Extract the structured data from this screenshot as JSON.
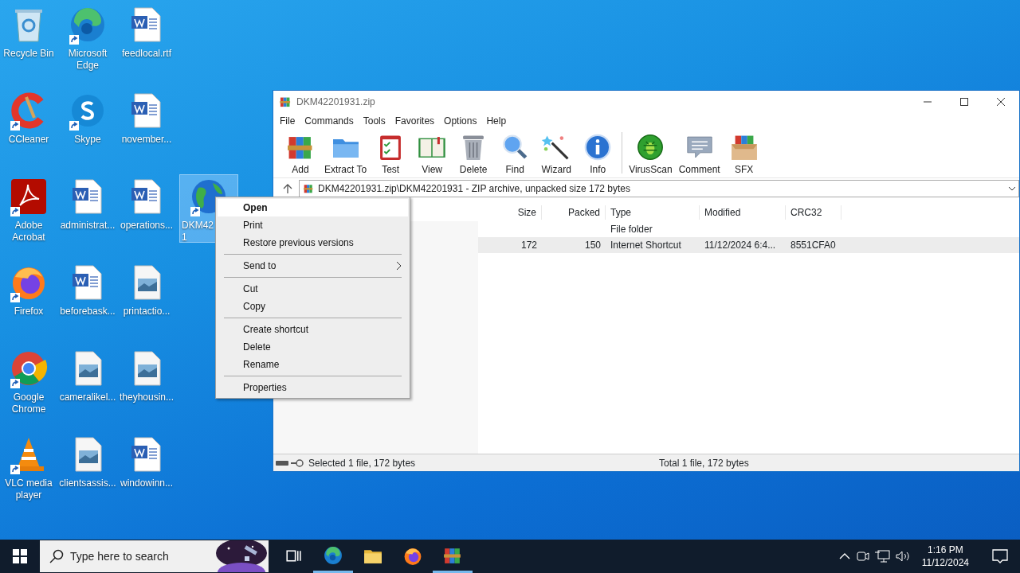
{
  "desktop_icons": [
    {
      "label": "Recycle Bin",
      "shortcut": false,
      "selected": false
    },
    {
      "label": "CCleaner",
      "shortcut": true,
      "selected": false
    },
    {
      "label": "Adobe Acrobat",
      "shortcut": true,
      "selected": false
    },
    {
      "label": "Firefox",
      "shortcut": true,
      "selected": false
    },
    {
      "label": "Google Chrome",
      "shortcut": true,
      "selected": false
    },
    {
      "label": "VLC media player",
      "shortcut": true,
      "selected": false
    },
    {
      "label": "Microsoft Edge",
      "shortcut": true,
      "selected": false
    },
    {
      "label": "Skype",
      "shortcut": true,
      "selected": false
    },
    {
      "label": "administrat...",
      "shortcut": false,
      "selected": false
    },
    {
      "label": "beforebask...",
      "shortcut": false,
      "selected": false
    },
    {
      "label": "cameralikel...",
      "shortcut": false,
      "selected": false
    },
    {
      "label": "clientsassis...",
      "shortcut": false,
      "selected": false
    },
    {
      "label": "feedlocal.rtf",
      "shortcut": false,
      "selected": false
    },
    {
      "label": "november...",
      "shortcut": false,
      "selected": false
    },
    {
      "label": "operations...",
      "shortcut": false,
      "selected": false
    },
    {
      "label": "printactio...",
      "shortcut": false,
      "selected": false
    },
    {
      "label": "theyhousin...",
      "shortcut": false,
      "selected": false
    },
    {
      "label": "windowinn...",
      "shortcut": false,
      "selected": false
    },
    {
      "label": "DKM42\n1",
      "shortcut": true,
      "selected": true
    }
  ],
  "window": {
    "title": "DKM42201931.zip",
    "menu": [
      "File",
      "Commands",
      "Tools",
      "Favorites",
      "Options",
      "Help"
    ],
    "toolbar": [
      "Add",
      "Extract To",
      "Test",
      "View",
      "Delete",
      "Find",
      "Wizard",
      "Info",
      "VirusScan",
      "Comment",
      "SFX"
    ],
    "address": "DKM42201931.zip\\DKM42201931 - ZIP archive, unpacked size 172 bytes",
    "columns": [
      "Size",
      "Packed",
      "Type",
      "Modified",
      "CRC32"
    ],
    "rows": [
      {
        "type": "File folder",
        "selected": false
      },
      {
        "size": "172",
        "packed": "150",
        "type": "Internet Shortcut",
        "modified": "11/12/2024 6:4...",
        "crc32": "8551CFA0",
        "selected": true
      }
    ],
    "status_left": "Selected 1 file, 172 bytes",
    "status_right": "Total 1 file, 172 bytes"
  },
  "context_menu": [
    {
      "kind": "item",
      "label": "Open",
      "bold": true,
      "selected": true,
      "submenu": false
    },
    {
      "kind": "item",
      "label": "Print",
      "bold": false,
      "selected": false,
      "submenu": false
    },
    {
      "kind": "item",
      "label": "Restore previous versions",
      "bold": false,
      "selected": false,
      "submenu": false
    },
    {
      "kind": "separator"
    },
    {
      "kind": "item",
      "label": "Send to",
      "bold": false,
      "selected": false,
      "submenu": true
    },
    {
      "kind": "separator"
    },
    {
      "kind": "item",
      "label": "Cut",
      "bold": false,
      "selected": false,
      "submenu": false
    },
    {
      "kind": "item",
      "label": "Copy",
      "bold": false,
      "selected": false,
      "submenu": false
    },
    {
      "kind": "separator"
    },
    {
      "kind": "item",
      "label": "Create shortcut",
      "bold": false,
      "selected": false,
      "submenu": false
    },
    {
      "kind": "item",
      "label": "Delete",
      "bold": false,
      "selected": false,
      "submenu": false
    },
    {
      "kind": "item",
      "label": "Rename",
      "bold": false,
      "selected": false,
      "submenu": false
    },
    {
      "kind": "separator"
    },
    {
      "kind": "item",
      "label": "Properties",
      "bold": false,
      "selected": false,
      "submenu": false
    }
  ],
  "taskbar": {
    "search_placeholder": "Type here to search",
    "apps": [
      {
        "running": false
      },
      {
        "running": true
      },
      {
        "running": false
      },
      {
        "running": false
      },
      {
        "running": true
      }
    ],
    "time": "1:16 PM",
    "date": "11/12/2024"
  }
}
